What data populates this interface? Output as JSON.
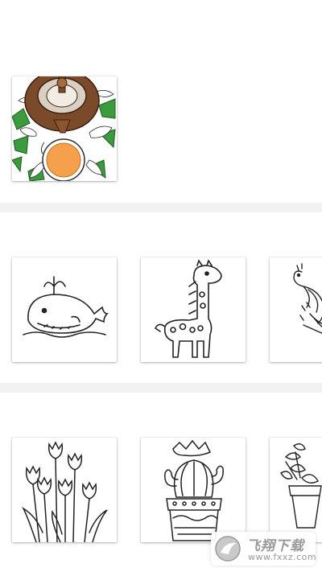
{
  "sections": [
    {
      "id": "recent",
      "cards": [
        {
          "name": "teapot-and-tea-cup-artwork",
          "colored": true
        }
      ]
    },
    {
      "id": "animals",
      "cards": [
        {
          "name": "whale-outline"
        },
        {
          "name": "giraffe-outline"
        },
        {
          "name": "peacock-outline"
        }
      ]
    },
    {
      "id": "plants",
      "cards": [
        {
          "name": "tulips-outline"
        },
        {
          "name": "cactus-pot-outline"
        },
        {
          "name": "succulent-pot-outline"
        }
      ]
    }
  ],
  "watermark": {
    "title": "飞翔下载",
    "subtitle": "www.fxxz.com"
  },
  "colors": {
    "page_background": "#f2f2f2",
    "card_background": "#ffffff",
    "teapot_brown": "#7b4a2a",
    "tea_orange": "#f5a04c",
    "leaf_green": "#3c9b3c"
  }
}
